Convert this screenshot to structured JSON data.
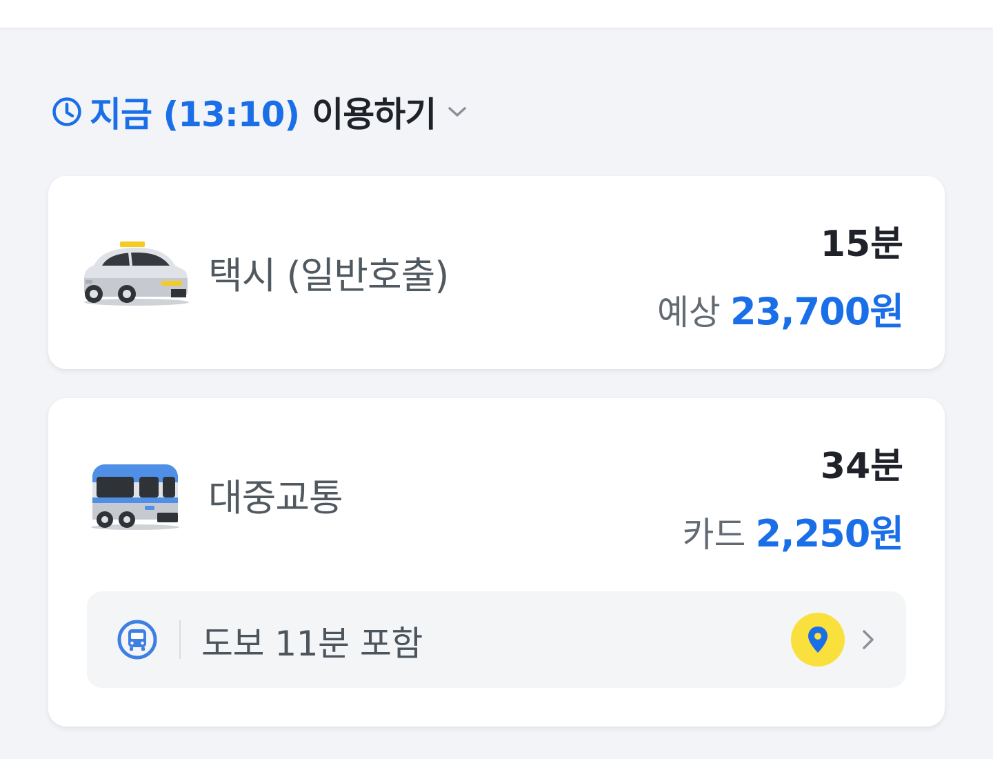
{
  "schedule": {
    "time_label": "지금 (13:10)",
    "action_label": "이용하기",
    "clock_icon": "clock-icon",
    "dropdown_icon": "chevron-down-icon"
  },
  "options": {
    "taxi": {
      "name": "택시 (일반호출)",
      "duration": "15분",
      "price_prefix": "예상",
      "price": "23,700원",
      "icon": "taxi-icon"
    },
    "transit": {
      "name": "대중교통",
      "duration": "34분",
      "price_prefix": "카드",
      "price": "2,250원",
      "icon": "bus-icon",
      "route": {
        "summary": "도보 11분 포함",
        "mode_icon": "bus-circle-icon",
        "map_icon": "location-pin-icon",
        "more_icon": "chevron-right-icon"
      }
    }
  },
  "colors": {
    "accent": "#1a6fe8",
    "background": "#f3f4f7",
    "card": "#ffffff",
    "pin_badge": "#fae03c"
  }
}
